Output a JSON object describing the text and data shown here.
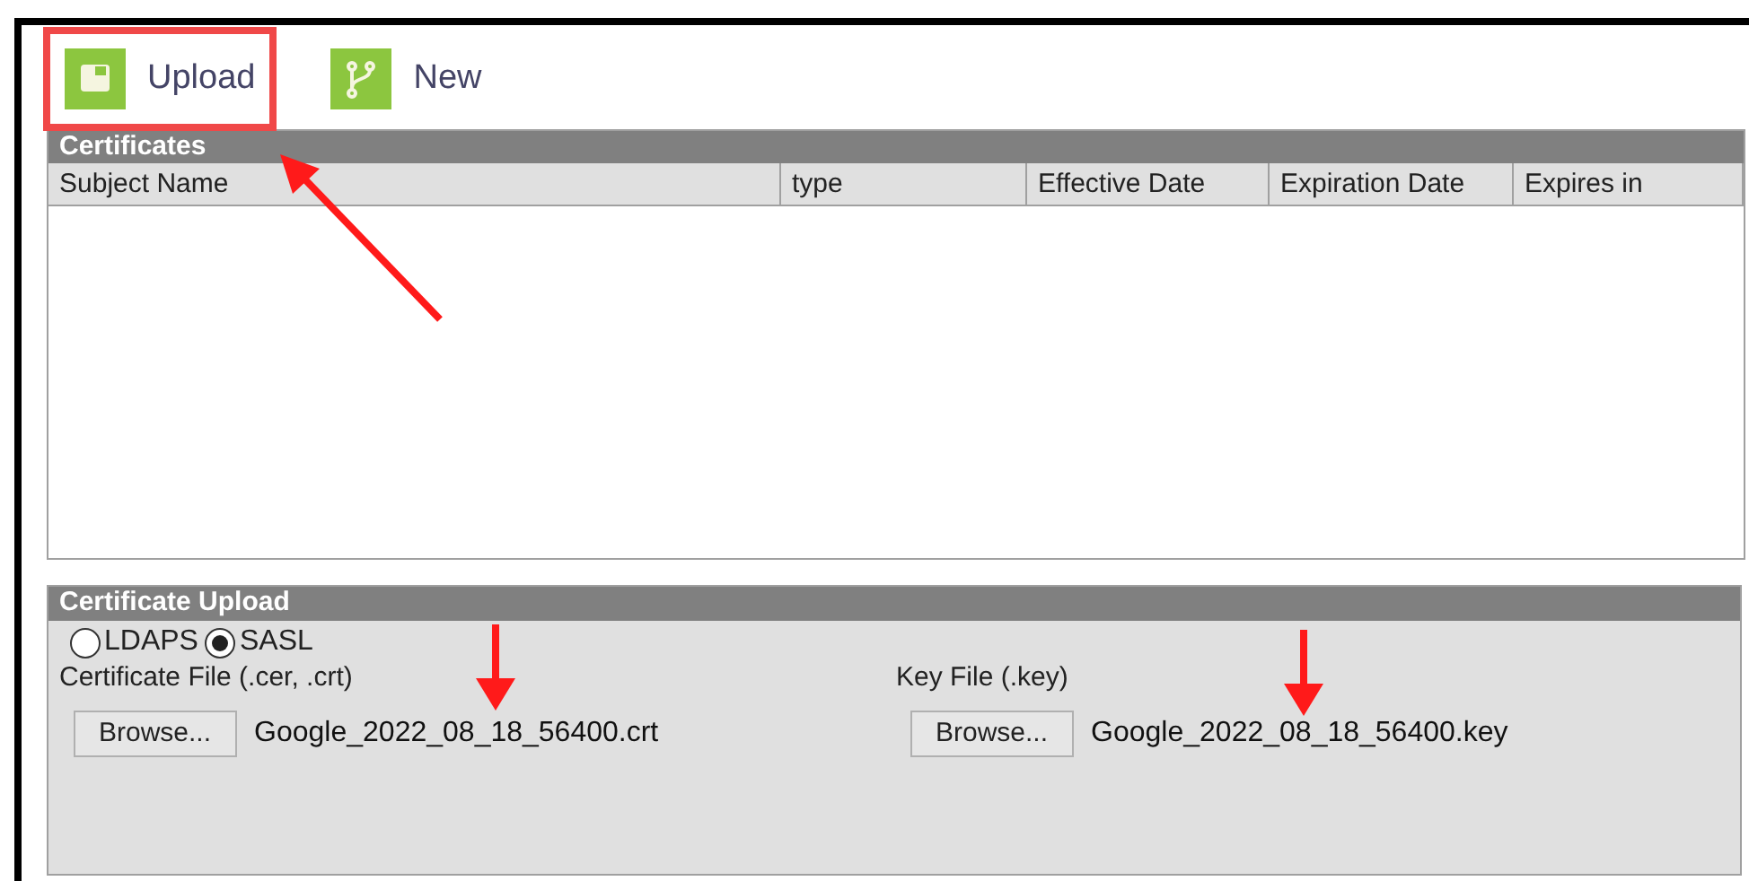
{
  "toolbar": [
    {
      "label": "Upload",
      "kind": "upload",
      "highlighted": true
    },
    {
      "label": "New",
      "kind": "new",
      "highlighted": false
    }
  ],
  "certificates": {
    "title": "Certificates",
    "columns": [
      "Subject Name",
      "type",
      "Effective Date",
      "Expiration Date",
      "Expires in"
    ]
  },
  "certificate_upload": {
    "title": "Certificate Upload",
    "radios": [
      {
        "label": "LDAPS",
        "selected": false
      },
      {
        "label": "SASL",
        "selected": true
      }
    ],
    "files": [
      {
        "label": "Certificate File (.cer, .crt)",
        "button": "Browse...",
        "value": "Google_2022_08_18_56400.crt"
      },
      {
        "label": "Key File (.key)",
        "button": "Browse...",
        "value": "Google_2022_08_18_56400.key"
      }
    ]
  }
}
